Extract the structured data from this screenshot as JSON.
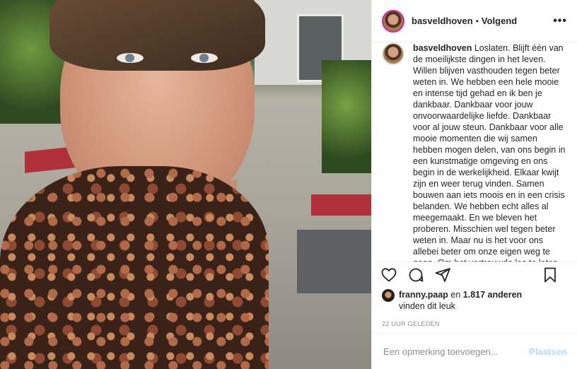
{
  "header": {
    "username": "basveldhoven",
    "separator": "•",
    "follow_status": "Volgend",
    "more_icon": "ellipsis-icon",
    "more_label": "•••"
  },
  "caption": {
    "username": "basveldhoven",
    "text": "Loslaten. Blijft één van de moeilijkste dingen in het leven. Willen blijven vasthouden tegen beter weten in. We hebben een hele mooie en intense tijd gehad en ik ben je dankbaar. Dankbaar voor jouw onvoorwaardelijke liefde. Dankbaar voor al jouw steun. Dankbaar voor alle mooie momenten die wij samen hebben mogen delen, van ons begin in een kunstmatige omgeving en ons begin in de werkelijkheid. Elkaar kwijt zijn en weer terug vinden. Samen bouwen aan iets moois en in een crisis belanden. We hebben echt alles al meegemaakt. En we bleven het proberen. Misschien wel tegen beter weten in. Maar nu is het voor ons allebei beter om onze eigen weg te gaan. Om het vertrouwde los te laten en alleen verder te gaan."
  },
  "actions": {
    "icons": [
      "heart-icon",
      "comment-icon",
      "share-icon",
      "bookmark-icon"
    ]
  },
  "likes": {
    "user": "franny.paap",
    "middle": " en ",
    "count": "1.817 anderen",
    "suffix": "vinden dit leuk"
  },
  "timestamp": "22 UUR GELEDEN",
  "comment_box": {
    "placeholder": "Een opmerking toevoegen...",
    "post_label": "Plaatsen"
  }
}
